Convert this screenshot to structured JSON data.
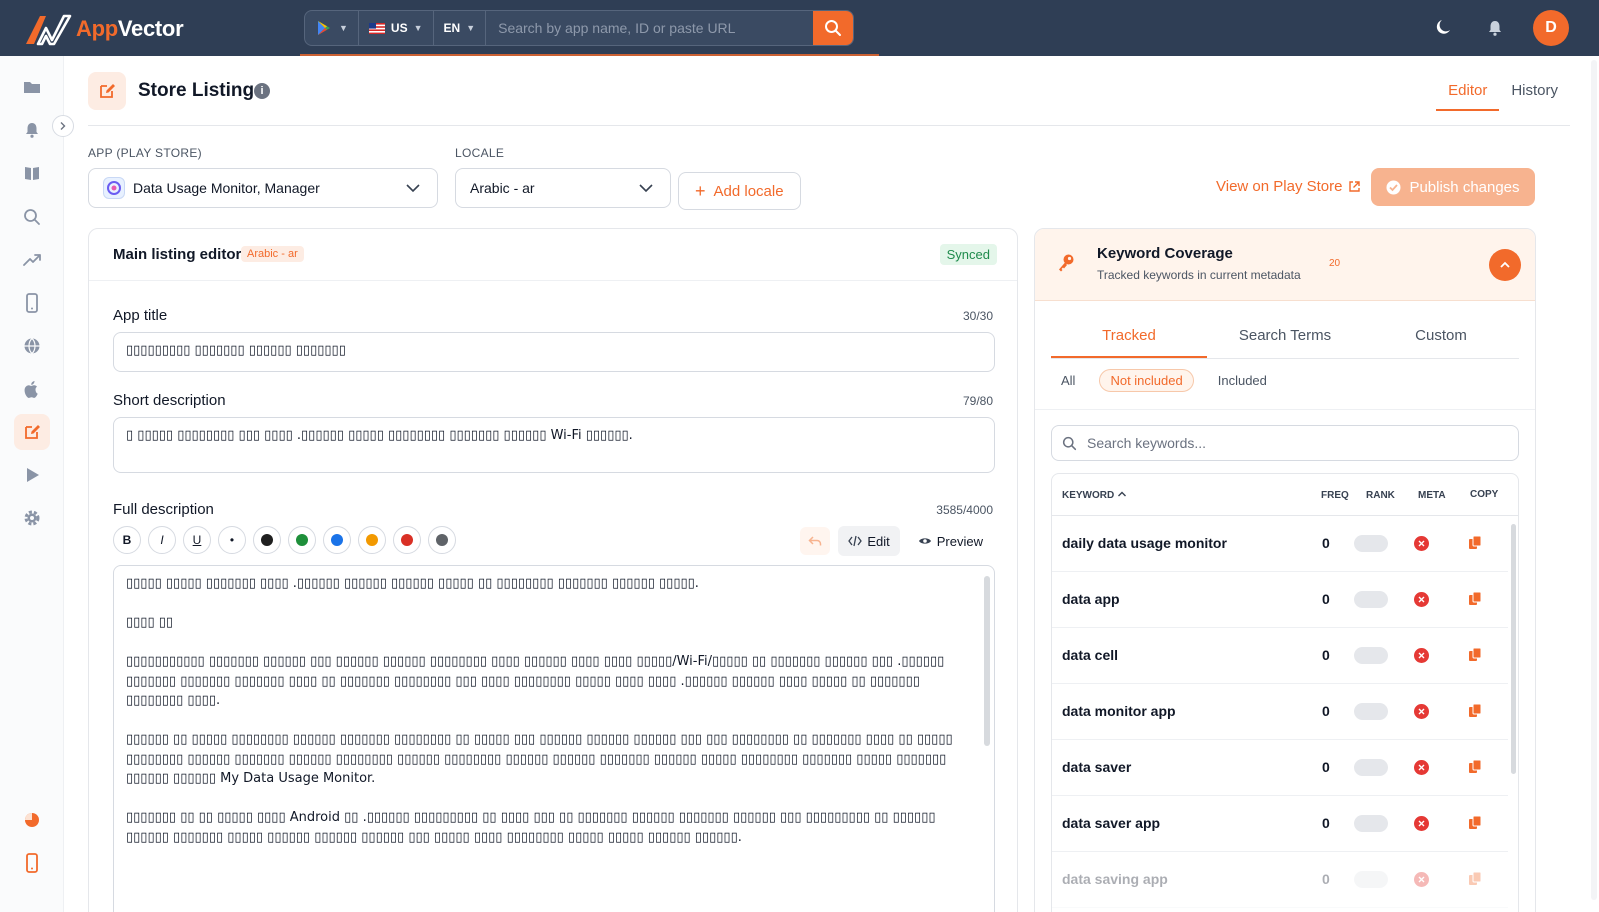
{
  "brand": {
    "name_a": "App",
    "name_b": "Vector",
    "accent": "#f26a2b",
    "topbar_bg": "#2f3e55"
  },
  "topbar": {
    "store_selector": "play-store-icon",
    "country": "US",
    "language": "EN",
    "search_placeholder": "Search by app name, ID or paste URL",
    "avatar_initial": "D"
  },
  "sidebar": {
    "items": [
      "folder-icon",
      "bell-icon",
      "book-icon",
      "search-icon",
      "trending-icon",
      "phone-icon",
      "globe-icon",
      "apple-icon",
      "edit-icon",
      "play-icon",
      "gear-icon"
    ],
    "active": "edit-icon"
  },
  "page": {
    "title": "Store Listing",
    "tabs": [
      {
        "label": "Editor",
        "active": true
      },
      {
        "label": "History",
        "active": false
      }
    ]
  },
  "controls": {
    "app_label": "APP (PLAY STORE)",
    "app_value": "Data Usage Monitor, Manager",
    "locale_label": "LOCALE",
    "locale_value": "Arabic - ar",
    "add_locale": "Add locale",
    "view_store": "View on Play Store",
    "publish": "Publish changes"
  },
  "editor": {
    "title": "Main listing editor",
    "locale_tag": "Arabic - ar",
    "status": "Synced",
    "app_title_label": "App title",
    "app_title_count": "30/30",
    "app_title_value": "▯▯▯▯▯▯▯▯▯ ▯▯▯▯▯▯▯ ▯▯▯▯▯▯ ▯▯▯▯▯▯▯",
    "short_label": "Short description",
    "short_count": "79/80",
    "short_value": "▯ ▯▯▯▯▯ ▯▯▯▯▯▯▯▯ ▯▯▯ ▯▯▯▯ .▯▯▯▯▯▯ ▯▯▯▯▯ ▯▯▯▯▯▯▯▯ ▯▯▯▯▯▯▯ ▯▯▯▯▯▯ Wi-Fi ▯▯▯▯▯▯.",
    "full_label": "Full description",
    "full_count": "3585/4000",
    "format_buttons": [
      "B",
      "I",
      "U",
      "•"
    ],
    "format_colors": [
      "#1f1f1f",
      "#1e8f3a",
      "#1a73e8",
      "#f29900",
      "#d93025",
      "#5f6368"
    ],
    "edit_label": "Edit",
    "preview_label": "Preview",
    "full_paragraphs": [
      "▯▯▯▯▯ ▯▯▯▯▯ ▯▯▯▯▯▯▯ ▯▯▯▯ .▯▯▯▯▯▯ ▯▯▯▯▯▯ ▯▯▯▯▯▯ ▯▯▯▯▯ ▯▯ ▯▯▯▯▯▯▯▯ ▯▯▯▯▯▯▯ ▯▯▯▯▯▯ ▯▯▯▯▯.",
      "▯▯▯▯ ▯▯",
      "▯▯▯▯▯▯▯▯▯▯▯ ▯▯▯▯▯▯▯ ▯▯▯▯▯▯ ▯▯▯ ▯▯▯▯▯▯ ▯▯▯▯▯▯ ▯▯▯▯▯▯▯▯ ▯▯▯▯ ▯▯▯▯▯▯ ▯▯▯▯ ▯▯▯▯ ▯▯▯▯▯/Wi-Fi/▯▯▯▯▯ ▯▯ ▯▯▯▯▯▯▯ ▯▯▯▯▯▯ ▯▯▯ .▯▯▯▯▯▯ ▯▯▯▯▯▯▯ ▯▯▯▯▯▯▯ ▯▯▯▯▯▯▯ ▯▯▯▯ ▯▯ ▯▯▯▯▯▯▯ ▯▯▯▯▯▯▯▯ ▯▯▯ ▯▯▯▯ ▯▯▯▯▯▯▯▯ ▯▯▯▯▯ ▯▯▯▯ ▯▯▯▯ .▯▯▯▯▯▯ ▯▯▯▯▯▯ ▯▯▯▯ ▯▯▯▯▯ ▯▯ ▯▯▯▯▯▯▯ ▯▯▯▯▯▯▯▯ ▯▯▯▯.",
      "▯▯▯▯▯▯ ▯▯ ▯▯▯▯▯ ▯▯▯▯▯▯▯▯ ▯▯▯▯▯▯ ▯▯▯▯▯▯▯ ▯▯▯▯▯▯▯▯ ▯▯ ▯▯▯▯▯ ▯▯▯ ▯▯▯▯▯▯ ▯▯▯▯▯▯ ▯▯▯▯▯▯ ▯▯▯ ▯▯▯ ▯▯▯▯▯▯▯▯ ▯▯ ▯▯▯▯▯▯▯ ▯▯▯▯ ▯▯ ▯▯▯▯▯ ▯▯▯▯▯▯▯▯ ▯▯▯▯▯▯ ▯▯▯▯▯▯▯ ▯▯▯▯▯▯ ▯▯▯▯▯▯▯▯ ▯▯▯▯▯▯ ▯▯▯▯▯▯▯▯ ▯▯▯▯▯▯ ▯▯▯▯▯▯ ▯▯▯▯▯▯▯ ▯▯▯▯▯▯ ▯▯▯▯▯ ▯▯▯▯▯▯▯▯ ▯▯▯▯▯▯▯ ▯▯▯▯▯ ▯▯▯▯▯▯▯ ▯▯▯▯▯▯ ▯▯▯▯▯▯ My Data Usage Monitor.",
      "▯▯▯▯▯▯▯ ▯▯ ▯▯ ▯▯▯▯▯ ▯▯▯▯ Android ▯▯ .▯▯▯▯▯▯ ▯▯▯▯▯▯▯▯▯ ▯▯ ▯▯▯▯ ▯▯▯ ▯▯ ▯▯▯▯▯▯▯ ▯▯▯▯▯▯ ▯▯▯▯▯▯▯ ▯▯▯▯▯▯ ▯▯▯ ▯▯▯▯▯▯▯▯▯ ▯▯ ▯▯▯▯▯▯ ▯▯▯▯▯▯ ▯▯▯▯▯▯▯ ▯▯▯▯▯ ▯▯▯▯▯▯ ▯▯▯▯▯▯ ▯▯▯▯▯▯ ▯▯▯ ▯▯▯▯▯ ▯▯▯▯ ▯▯▯▯▯▯▯▯ ▯▯▯▯▯ ▯▯▯▯▯ ▯▯▯▯▯▯ ▯▯▯▯▯▯."
    ]
  },
  "keywords": {
    "title": "Keyword Coverage",
    "subtitle": "Tracked keywords in current metadata",
    "count": "20",
    "tabs": [
      {
        "label": "Tracked",
        "active": true
      },
      {
        "label": "Search Terms",
        "active": false
      },
      {
        "label": "Custom",
        "active": false
      }
    ],
    "filters": [
      {
        "label": "All",
        "active": false
      },
      {
        "label": "Not included",
        "active": true
      },
      {
        "label": "Included",
        "active": false
      }
    ],
    "search_placeholder": "Search keywords...",
    "columns": {
      "keyword": "KEYWORD",
      "freq": "FREQ",
      "rank": "RANK",
      "meta": "META",
      "copy": "COPY"
    },
    "rows": [
      {
        "keyword": "daily data usage monitor",
        "freq": "0"
      },
      {
        "keyword": "data app",
        "freq": "0"
      },
      {
        "keyword": "data cell",
        "freq": "0"
      },
      {
        "keyword": "data monitor app",
        "freq": "0"
      },
      {
        "keyword": "data saver",
        "freq": "0"
      },
      {
        "keyword": "data saver app",
        "freq": "0"
      },
      {
        "keyword": "data saving app",
        "freq": "0"
      }
    ]
  }
}
